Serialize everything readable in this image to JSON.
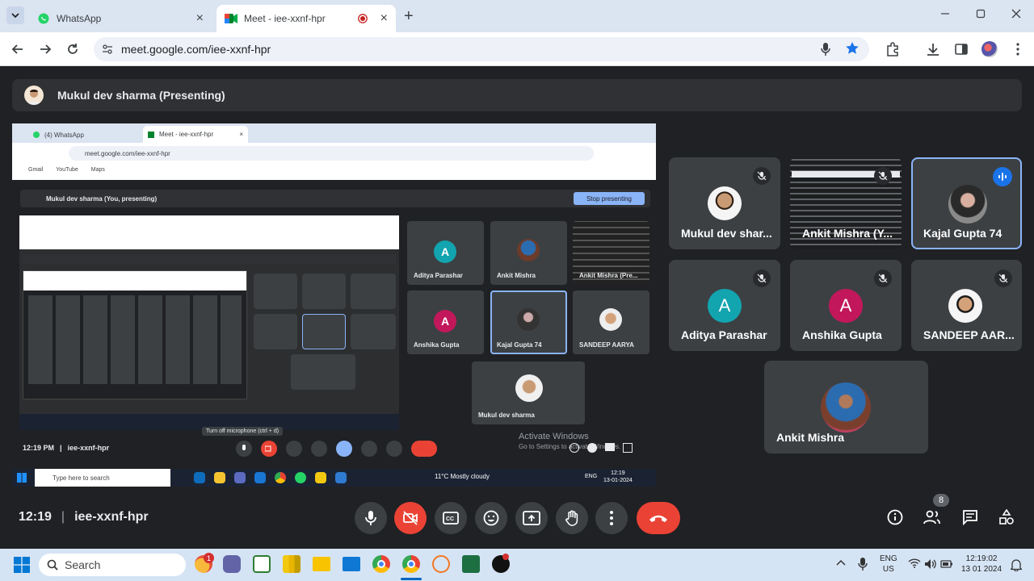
{
  "browser": {
    "tabs": [
      {
        "title": "WhatsApp",
        "active": false
      },
      {
        "title": "Meet - iee-xxnf-hpr",
        "active": true
      }
    ],
    "new_tab_label": "+",
    "url": "meet.google.com/iee-xxnf-hpr"
  },
  "meet": {
    "presenter_label": "Mukul dev sharma (Presenting)",
    "participants": [
      {
        "name": "Mukul dev shar...",
        "muted": true,
        "avatar": "photo"
      },
      {
        "name": "Ankit Mishra (Y...",
        "muted": true,
        "avatar": "screen"
      },
      {
        "name": "Kajal Gupta 74",
        "speaking": true,
        "avatar": "photo"
      },
      {
        "name": "Aditya Parashar",
        "muted": true,
        "avatar": "letter",
        "letter": "A",
        "color": "#12a4af"
      },
      {
        "name": "Anshika Gupta",
        "muted": true,
        "avatar": "letter",
        "letter": "A",
        "color": "#c2185b"
      },
      {
        "name": "SANDEEP AAR...",
        "muted": true,
        "avatar": "photo"
      },
      {
        "name": "Ankit Mishra",
        "muted": false,
        "avatar": "photo"
      }
    ],
    "time": "12:19",
    "separator": "|",
    "meeting_code": "iee-xxnf-hpr",
    "people_count": "8"
  },
  "shared_screen": {
    "tabs": [
      "(4) WhatsApp",
      "Meet - iee-xxnf-hpr"
    ],
    "url": "meet.google.com/iee-xxnf-hpr",
    "bookmarks": [
      "Gmail",
      "YouTube",
      "Maps"
    ],
    "presenting_label": "Mukul dev sharma (You, presenting)",
    "stop_label": "Stop presenting",
    "tiles": [
      {
        "name": "Aditya Parashar",
        "letter": "A",
        "color": "#12a4af"
      },
      {
        "name": "Ankit Mishra"
      },
      {
        "name": "Ankit Mishra (Pre..."
      },
      {
        "name": "Anshika Gupta",
        "letter": "A",
        "color": "#c2185b"
      },
      {
        "name": "Kajal Gupta 74"
      },
      {
        "name": "SANDEEP AARYA"
      },
      {
        "name": "Mukul dev sharma"
      }
    ],
    "activate_title": "Activate Windows",
    "activate_sub": "Go to Settings to activate Windows.",
    "time": "12:19 PM",
    "separator": "|",
    "code": "iee-xxnf-hpr",
    "tooltip": "Turn off microphone (ctrl + d)",
    "taskbar_search": "Type here to search",
    "weather": "11°C  Mostly cloudy",
    "lang": "ENG",
    "clock_time": "12:19",
    "clock_date": "13-01-2024"
  },
  "taskbar": {
    "search_placeholder": "Search",
    "lang": "ENG",
    "region": "US",
    "time": "12:19:02",
    "date": "13 01 2024",
    "notification_count": "1"
  },
  "colors": {
    "meet_bg": "#202124",
    "tile_bg": "#3c4043",
    "red": "#ea4335",
    "accent": "#8ab4f8",
    "chrome_tabstrip": "#dbe4f1"
  }
}
